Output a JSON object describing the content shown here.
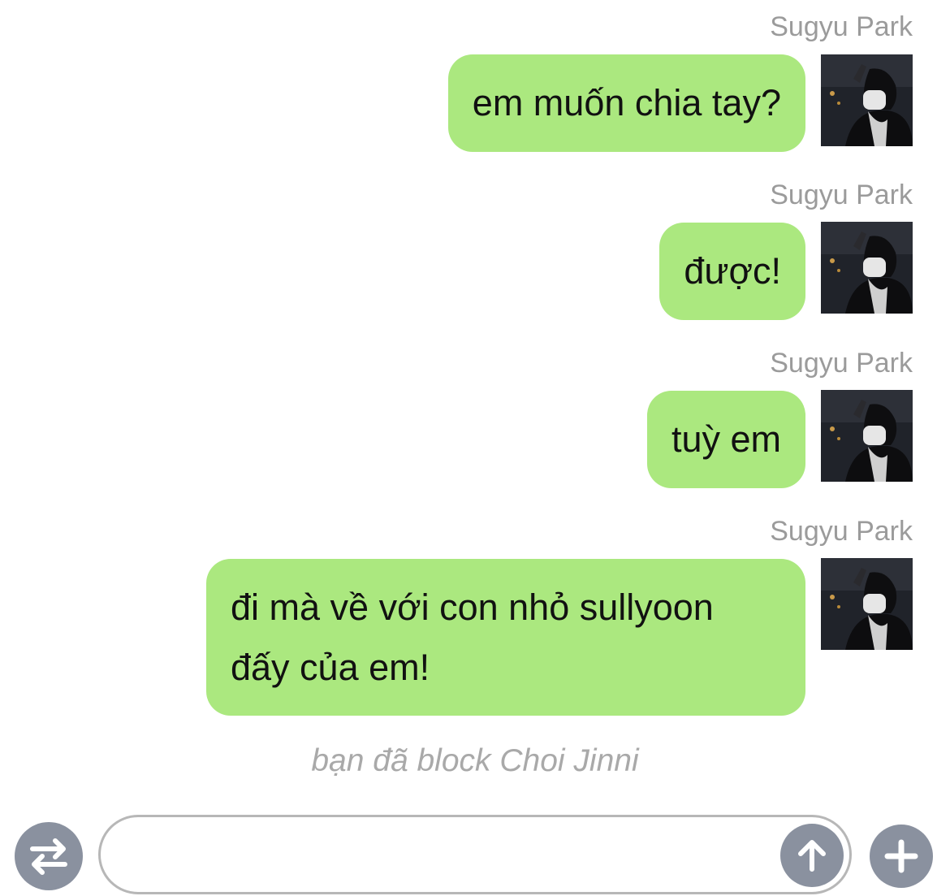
{
  "colors": {
    "outgoing_bubble": "#abe87f",
    "sender_name": "#9b9b9b",
    "system_note": "#a9a9a9",
    "round_button": "#8a919f",
    "input_border": "#b7b7b7"
  },
  "messages": [
    {
      "sender": "Sugyu Park",
      "text": "em muốn chia tay?"
    },
    {
      "sender": "Sugyu Park",
      "text": "được!"
    },
    {
      "sender": "Sugyu Park",
      "text": "tuỳ em"
    },
    {
      "sender": "Sugyu Park",
      "text": "đi mà về với con nhỏ sullyoon đấy của em!"
    }
  ],
  "system_note": "bạn đã block Choi Jinni",
  "composer": {
    "input_value": "",
    "input_placeholder": "",
    "left_button_icon": "swap-arrows-icon",
    "send_button_icon": "arrow-up-icon",
    "add_button_icon": "plus-icon"
  }
}
